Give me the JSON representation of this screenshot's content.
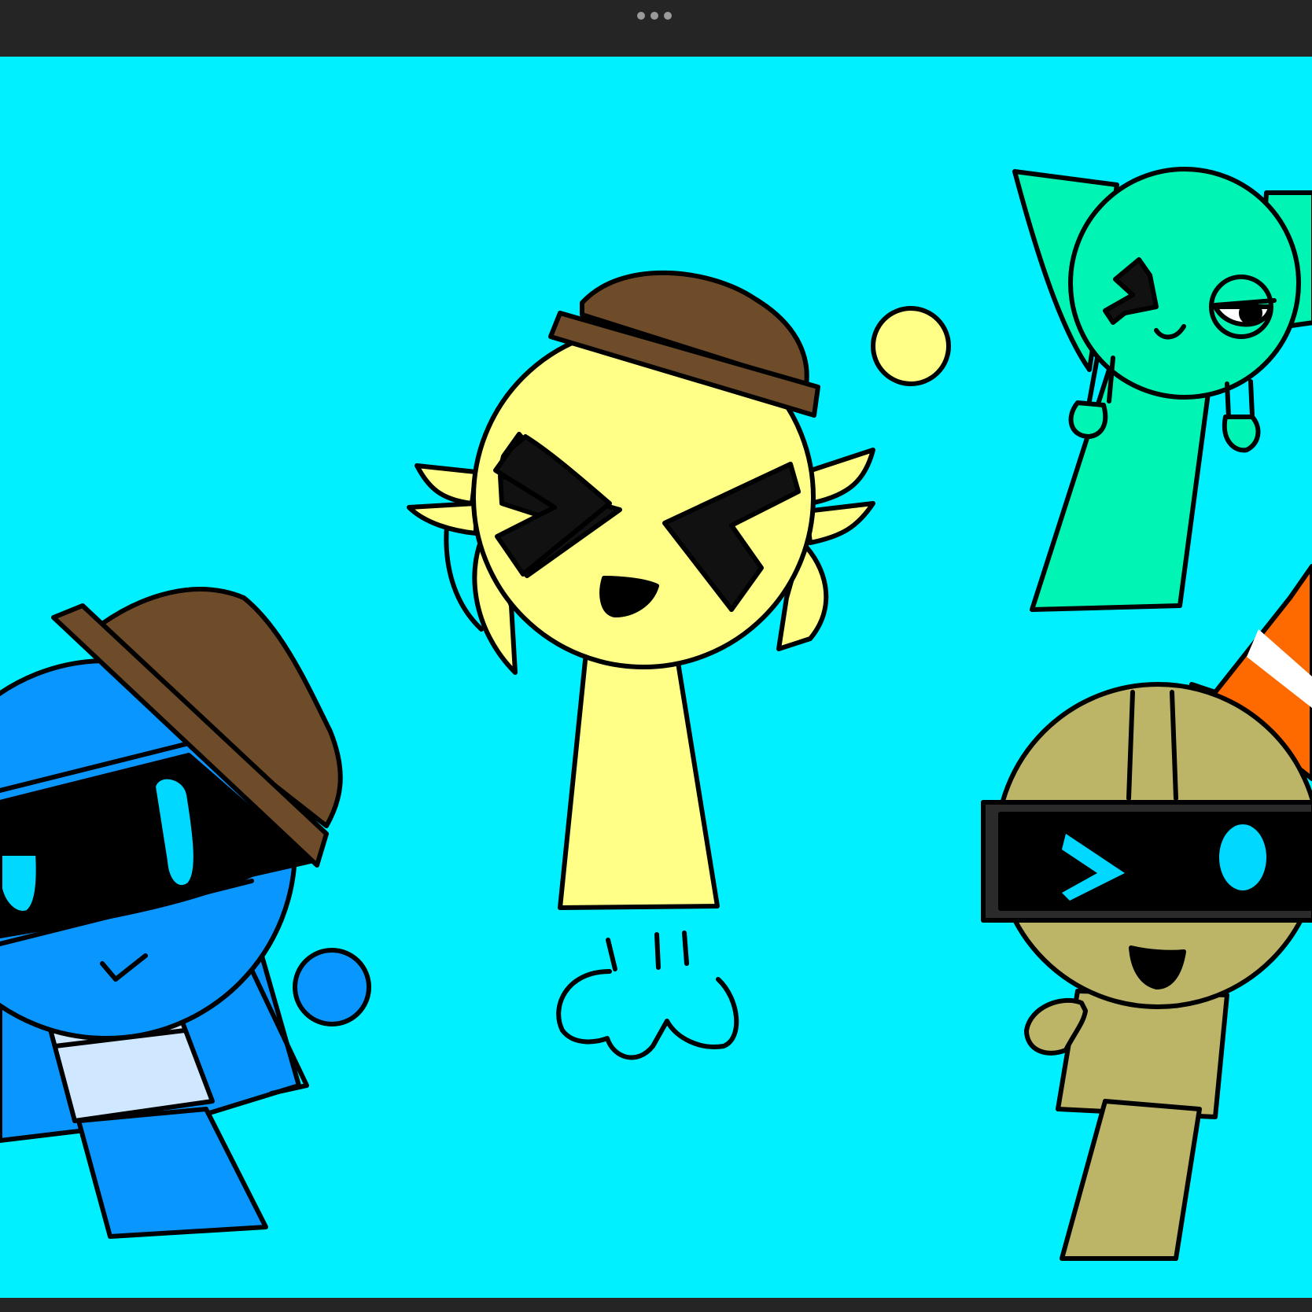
{
  "app": {
    "toolbar": {
      "more_icon": "more-horizontal-icon"
    }
  },
  "canvas": {
    "background_color": "#00f0ff",
    "colors": {
      "yellow": "#ffff88",
      "brown": "#6e4c2a",
      "green": "#00f5b4",
      "blue": "#0a96ff",
      "light_blue": "#cfe8ff",
      "tan": "#bcb467",
      "orange": "#ff6a00",
      "eye_cyan": "#00d8ff",
      "outline": "#000000"
    },
    "characters": [
      "yellow-character",
      "green-character",
      "blue-character",
      "tan-character"
    ]
  }
}
